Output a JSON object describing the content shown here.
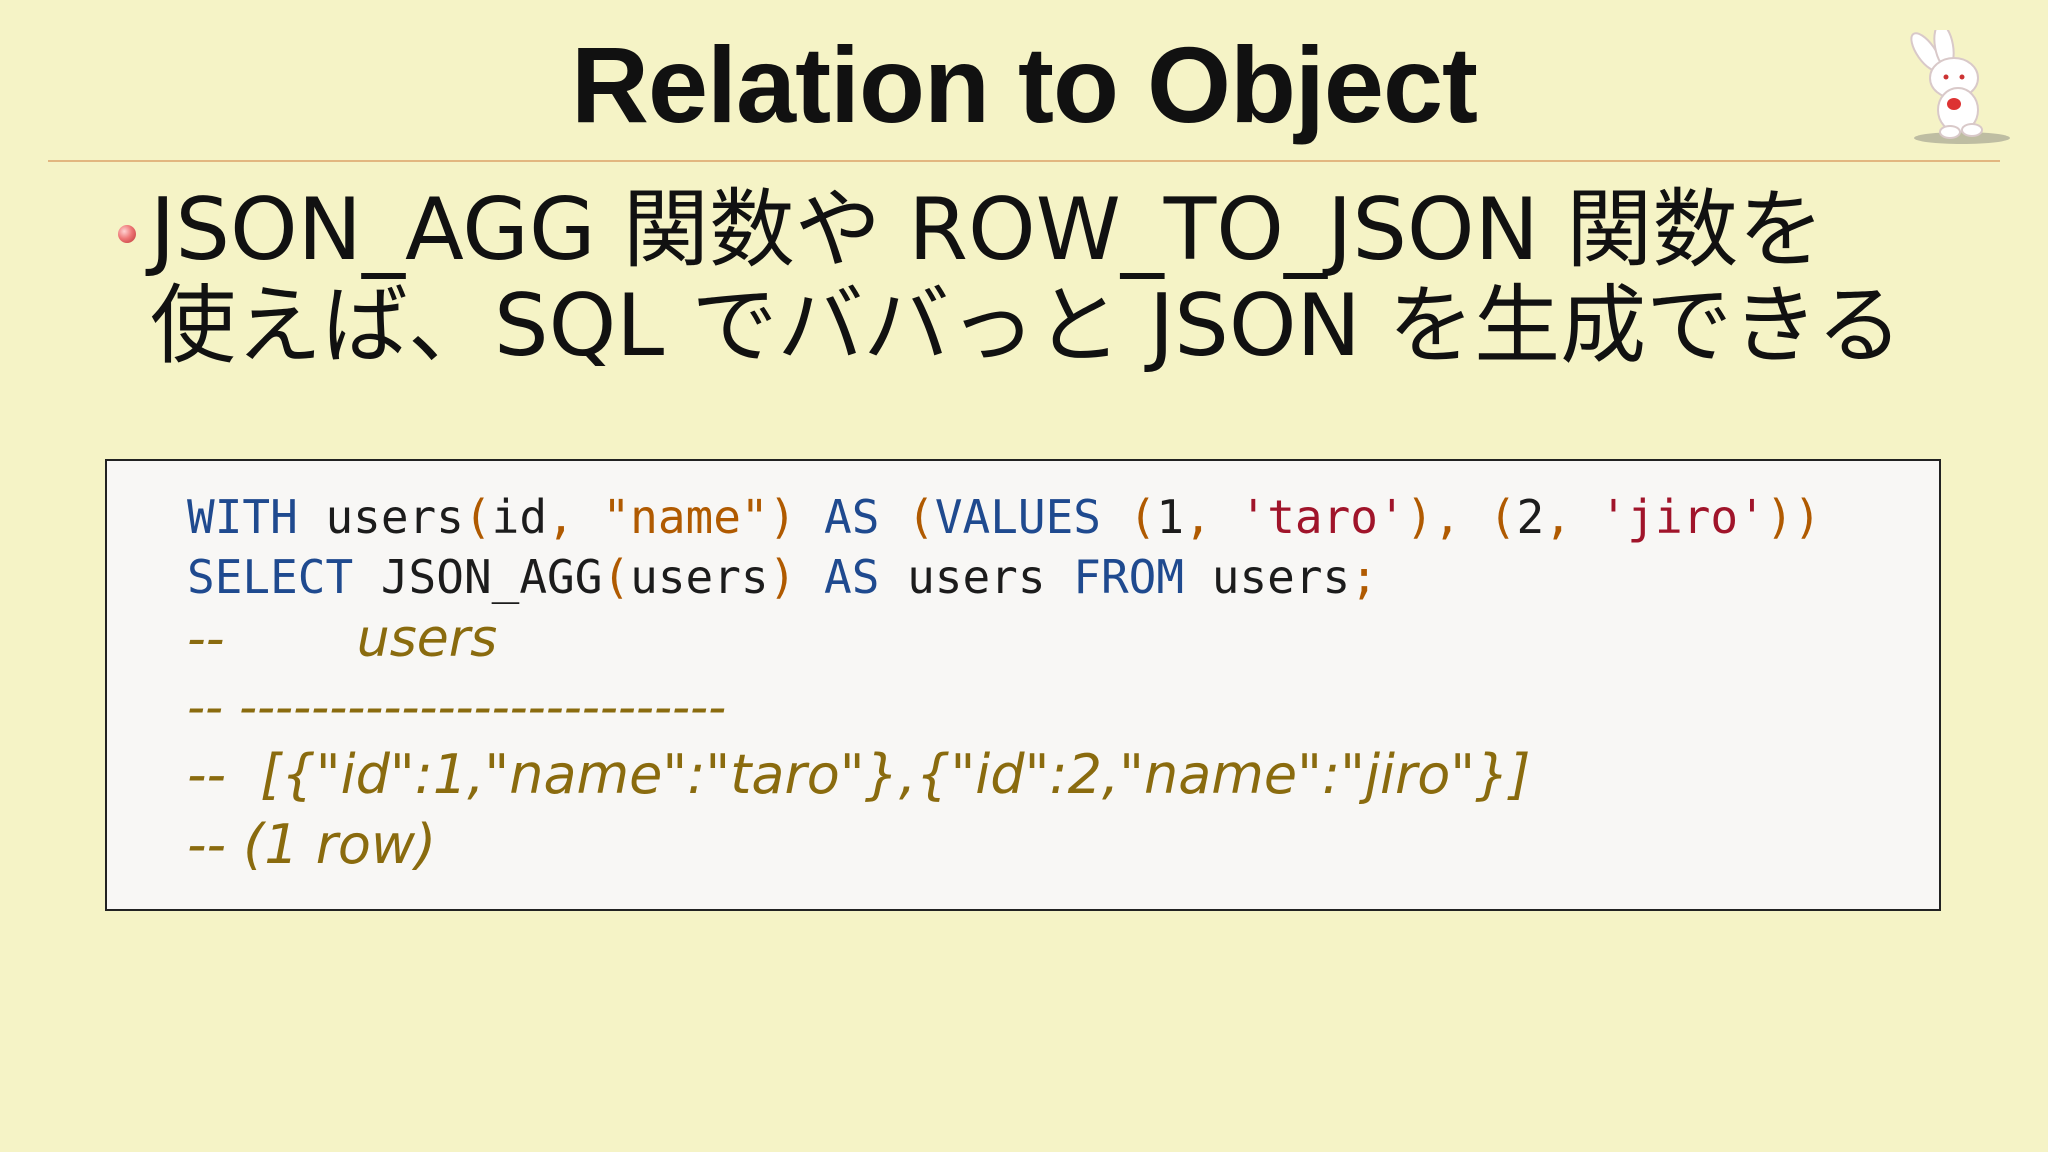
{
  "slide": {
    "title": "Relation to Object",
    "bullet_line1": "JSON_AGG 関数や ROW_TO_JSON 関数を",
    "bullet_line2": "使えば、SQL でババっと JSON を生成できる"
  },
  "code": {
    "line1": {
      "t1": "WITH",
      "t2": " users",
      "t3": "(",
      "t4": "id",
      "t5": ",",
      "t6": " ",
      "t7": "\"name\"",
      "t8": ")",
      "t9": " ",
      "t10": "AS",
      "t11": " ",
      "t12": "(",
      "t13": "VALUES",
      "t14": " ",
      "t15": "(",
      "t16": "1",
      "t17": ",",
      "t18": " ",
      "t19": "'taro'",
      "t20": ")",
      "t21": ",",
      "t22": " ",
      "t23": "(",
      "t24": "2",
      "t25": ",",
      "t26": " ",
      "t27": "'jiro'",
      "t28": "))"
    },
    "line2": {
      "t1": "SELECT",
      "t2": " JSON_AGG",
      "t3": "(",
      "t4": "users",
      "t5": ")",
      "t6": " ",
      "t7": "AS",
      "t8": " users ",
      "t9": "FROM",
      "t10": " users",
      "t11": ";"
    },
    "comment1": "--        users",
    "comment2": "-- ---------------------------",
    "comment3": "--  [{\"id\":1,\"name\":\"taro\"},{\"id\":2,\"name\":\"jiro\"}]",
    "comment4": "-- (1 row)"
  }
}
